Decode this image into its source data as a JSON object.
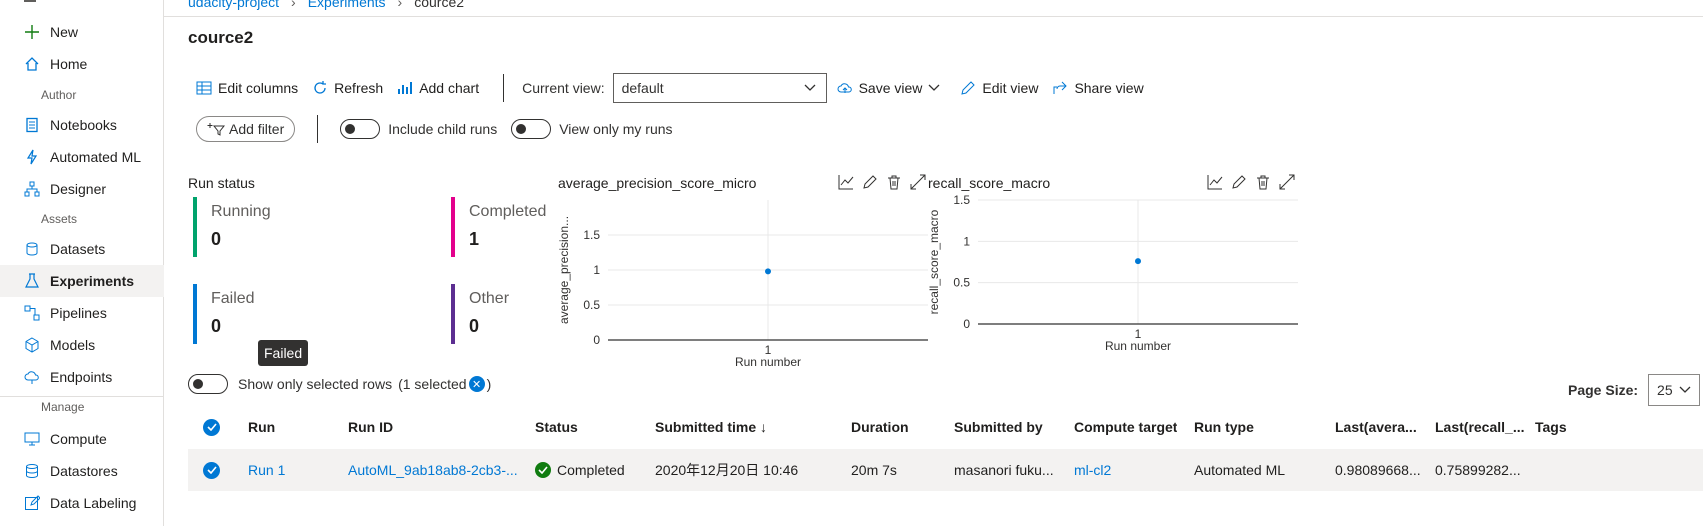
{
  "sidebar": {
    "items": {
      "new": "New",
      "home": "Home",
      "notebooks": "Notebooks",
      "automated_ml": "Automated ML",
      "designer": "Designer",
      "datasets": "Datasets",
      "experiments": "Experiments",
      "pipelines": "Pipelines",
      "models": "Models",
      "endpoints": "Endpoints",
      "compute": "Compute",
      "datastores": "Datastores",
      "data_labeling": "Data Labeling"
    },
    "sections": {
      "author": "Author",
      "assets": "Assets",
      "manage": "Manage"
    },
    "active": "Experiments"
  },
  "breadcrumb": {
    "workspace": "udacity-project",
    "experiments": "Experiments",
    "current": "cource2"
  },
  "page_title": "cource2",
  "toolbar": {
    "edit_columns": "Edit columns",
    "refresh": "Refresh",
    "add_chart": "Add chart",
    "current_view_label": "Current view:",
    "current_view_value": "default",
    "save_view": "Save view",
    "edit_view": "Edit view",
    "share_view": "Share view"
  },
  "filters": {
    "add_filter": "Add filter",
    "include_child_runs": "Include child runs",
    "view_only_my_runs": "View only my runs"
  },
  "run_status": {
    "title": "Run status",
    "running": {
      "label": "Running",
      "value": "0",
      "color": "#00a36c"
    },
    "completed": {
      "label": "Completed",
      "value": "1",
      "color": "#e3008c"
    },
    "failed": {
      "label": "Failed",
      "value": "0",
      "color": "#0078d4"
    },
    "other": {
      "label": "Other",
      "value": "0",
      "color": "#5c2e91"
    }
  },
  "tooltip": "Failed",
  "chart_data": [
    {
      "type": "scatter",
      "title": "average_precision_score_micro",
      "xlabel": "Run number",
      "ylabel": "average_precision...",
      "x": [
        1
      ],
      "y": [
        0.98
      ],
      "xticks": [
        "1"
      ],
      "yticks": [
        "0",
        "0.5",
        "1",
        "1.5"
      ],
      "ylim": [
        0,
        2
      ],
      "color": "#0078d4"
    },
    {
      "type": "scatter",
      "title": "recall_score_macro",
      "xlabel": "Run number",
      "ylabel": "recall_score_macro",
      "x": [
        1
      ],
      "y": [
        0.76
      ],
      "xticks": [
        "1"
      ],
      "yticks": [
        "0",
        "0.5",
        "1",
        "1.5"
      ],
      "ylim": [
        0,
        1.5
      ],
      "color": "#0078d4"
    }
  ],
  "selection": {
    "show_only_selected": "Show only selected rows",
    "selected_open": "(1 selected",
    "selected_close": ")"
  },
  "page_size": {
    "label": "Page Size:",
    "value": "25"
  },
  "table": {
    "headers": {
      "run": "Run",
      "run_id": "Run ID",
      "status": "Status",
      "submitted_time": "Submitted time ↓",
      "duration": "Duration",
      "submitted_by": "Submitted by",
      "compute_target": "Compute target",
      "run_type": "Run type",
      "last_avg": "Last(avera...",
      "last_recall": "Last(recall_...",
      "tags": "Tags"
    },
    "rows": [
      {
        "run": "Run 1",
        "run_id": "AutoML_9ab18ab8-2cb3-...",
        "status": "Completed",
        "submitted_time": "2020年12月20日 10:46",
        "duration": "20m 7s",
        "submitted_by": "masanori fuku...",
        "compute_target": "ml-cl2",
        "run_type": "Automated ML",
        "last_avg": "0.98089668...",
        "last_recall": "0.75899282..."
      }
    ]
  }
}
